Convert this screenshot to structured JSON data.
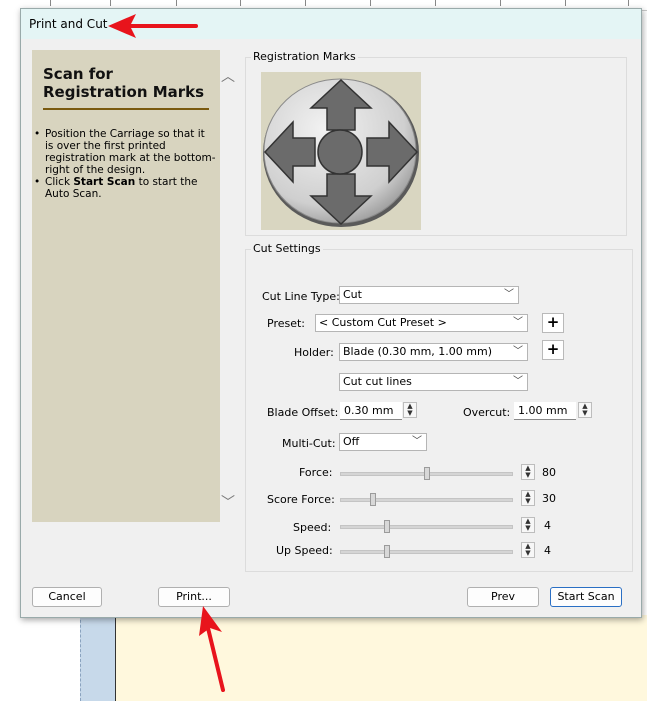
{
  "dialog": {
    "title": "Print and Cut"
  },
  "instructions": {
    "title": "Scan for Registration Marks",
    "steps": [
      {
        "text": "Position the Carriage so that it is over the first printed registration mark at the bottom-right of the design."
      },
      {
        "pre": "Click ",
        "bold": "Start Scan",
        "post": " to start the Auto Scan."
      }
    ]
  },
  "registration": {
    "group_label": "Registration Marks"
  },
  "cut_settings": {
    "group_label": "Cut Settings",
    "cut_line_type": {
      "label": "Cut Line Type:",
      "value": "Cut"
    },
    "preset": {
      "label": "Preset:",
      "value": "< Custom Cut Preset >"
    },
    "holder": {
      "label": "Holder:",
      "value": "Blade (0.30 mm, 1.00 mm)"
    },
    "cut_lines": {
      "value": "Cut cut lines"
    },
    "blade_offset": {
      "label": "Blade Offset:",
      "value": "0.30 mm"
    },
    "overcut": {
      "label": "Overcut:",
      "value": "1.00 mm"
    },
    "multi_cut": {
      "label": "Multi-Cut:",
      "value": "Off"
    },
    "force": {
      "label": "Force:",
      "value": "80",
      "level": 0.5
    },
    "score_force": {
      "label": "Score Force:",
      "value": "30",
      "level": 0.19
    },
    "speed": {
      "label": "Speed:",
      "value": "4",
      "level": 0.27
    },
    "up_speed": {
      "label": "Up Speed:",
      "value": "4",
      "level": 0.27
    }
  },
  "buttons": {
    "cancel": "Cancel",
    "print": "Print...",
    "prev": "Prev",
    "start_scan": "Start Scan"
  },
  "colors": {
    "annotation_arrow": "#e8141c",
    "titlebar": "#e4f5f5",
    "instruction_panel": "#d8d4bf"
  }
}
